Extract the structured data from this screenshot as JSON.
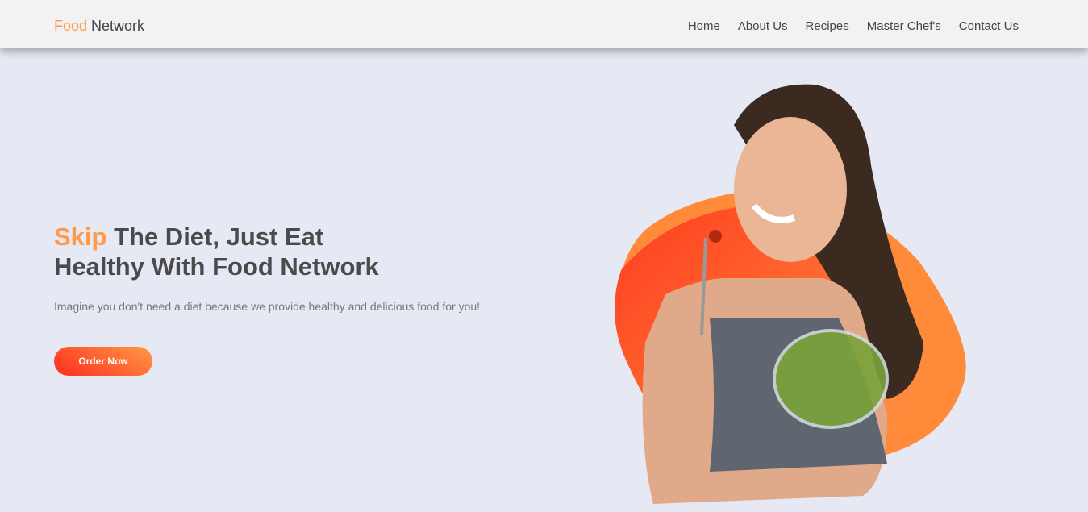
{
  "brand": {
    "accent": "Food",
    "rest": " Network"
  },
  "nav": {
    "items": [
      "Home",
      "About Us",
      "Recipes",
      "Master Chef's",
      "Contact Us"
    ]
  },
  "hero": {
    "title_accent": "Skip",
    "title_line1": " The Diet, Just Eat",
    "title_line2": "Healthy With Food Network",
    "description": "Imagine you don't need a diet because we provide healthy and delicious food for you!",
    "cta": "Order Now"
  },
  "colors": {
    "accent": "#ff9a3c",
    "button_start": "#ff2b1f",
    "button_end": "#ff9a45"
  }
}
